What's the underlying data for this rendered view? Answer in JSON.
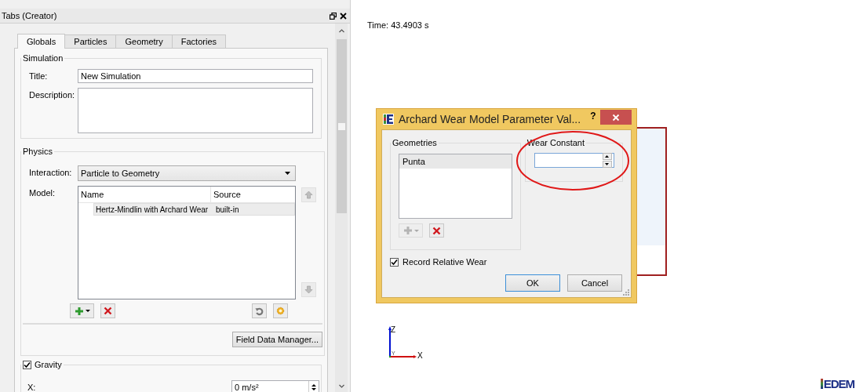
{
  "panel": {
    "title": "Tabs (Creator)"
  },
  "tabs": [
    {
      "label": "Globals",
      "selected": true
    },
    {
      "label": "Particles",
      "selected": false
    },
    {
      "label": "Geometry",
      "selected": false
    },
    {
      "label": "Factories",
      "selected": false
    }
  ],
  "simulation": {
    "heading": "Simulation",
    "title_label": "Title:",
    "title_value": "New Simulation",
    "description_label": "Description:"
  },
  "physics": {
    "heading": "Physics",
    "interaction_label": "Interaction:",
    "interaction_value": "Particle to Geometry",
    "model_label": "Model:",
    "columns": [
      "Name",
      "Source"
    ],
    "rows": [
      {
        "name": "Hertz-Mindlin with Archard Wear",
        "source": "built-in",
        "selected": true
      }
    ],
    "field_data_button": "Field Data Manager..."
  },
  "gravity": {
    "label": "Gravity",
    "checked": true,
    "x_label": "X:",
    "x_value": "0 m/s²"
  },
  "viewer": {
    "time": "Time: 43.4903 s",
    "axes": {
      "z": "Z",
      "y": "Y",
      "x": "X"
    },
    "logo": "EDEM"
  },
  "dialog": {
    "title": "Archard Wear Model Parameter Val...",
    "help": "?",
    "geometries_heading": "Geometries",
    "geometries": [
      {
        "label": "Punta",
        "selected": true
      }
    ],
    "add_button": {
      "disabled": true
    },
    "wear_constant_heading": "Wear Constant",
    "record_wear": {
      "label": "Record Relative Wear",
      "checked": true
    },
    "buttons": [
      "OK",
      "Cancel"
    ]
  }
}
